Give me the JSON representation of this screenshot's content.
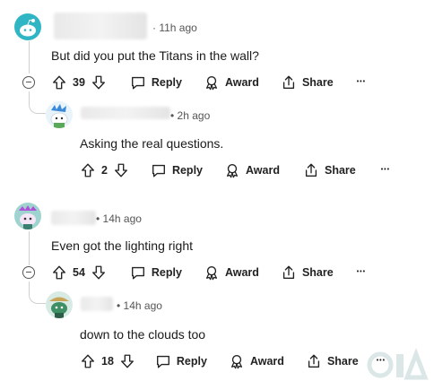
{
  "comments": [
    {
      "time": "11h ago",
      "text": "But did you put the Titans in the wall?",
      "score": "39",
      "reply_label": "Reply",
      "award_label": "Award",
      "share_label": "Share",
      "more_label": "•••",
      "reply": {
        "time": "2h ago",
        "text": "Asking the real questions.",
        "score": "2",
        "reply_label": "Reply",
        "award_label": "Award",
        "share_label": "Share",
        "more_label": "•••"
      }
    },
    {
      "time": "14h ago",
      "text": "Even got the lighting right",
      "score": "54",
      "reply_label": "Reply",
      "award_label": "Award",
      "share_label": "Share",
      "more_label": "•••",
      "reply": {
        "time": "14h ago",
        "text": "down to the clouds too",
        "score": "18",
        "reply_label": "Reply",
        "award_label": "Award",
        "share_label": "Share",
        "more_label": "•••"
      }
    }
  ],
  "colors": {
    "text": "#1a1a1b",
    "meta": "#555555",
    "thread_line": "#d0d0d0",
    "avatar1": "#2fb5c4",
    "avatar2": "#e8f3fa",
    "avatar3": "#9ed3cf",
    "avatar4": "#d7ebe4"
  },
  "icons": [
    "upvote-icon",
    "downvote-icon",
    "reply-icon",
    "award-icon",
    "share-icon",
    "collapse-icon",
    "more-icon"
  ]
}
